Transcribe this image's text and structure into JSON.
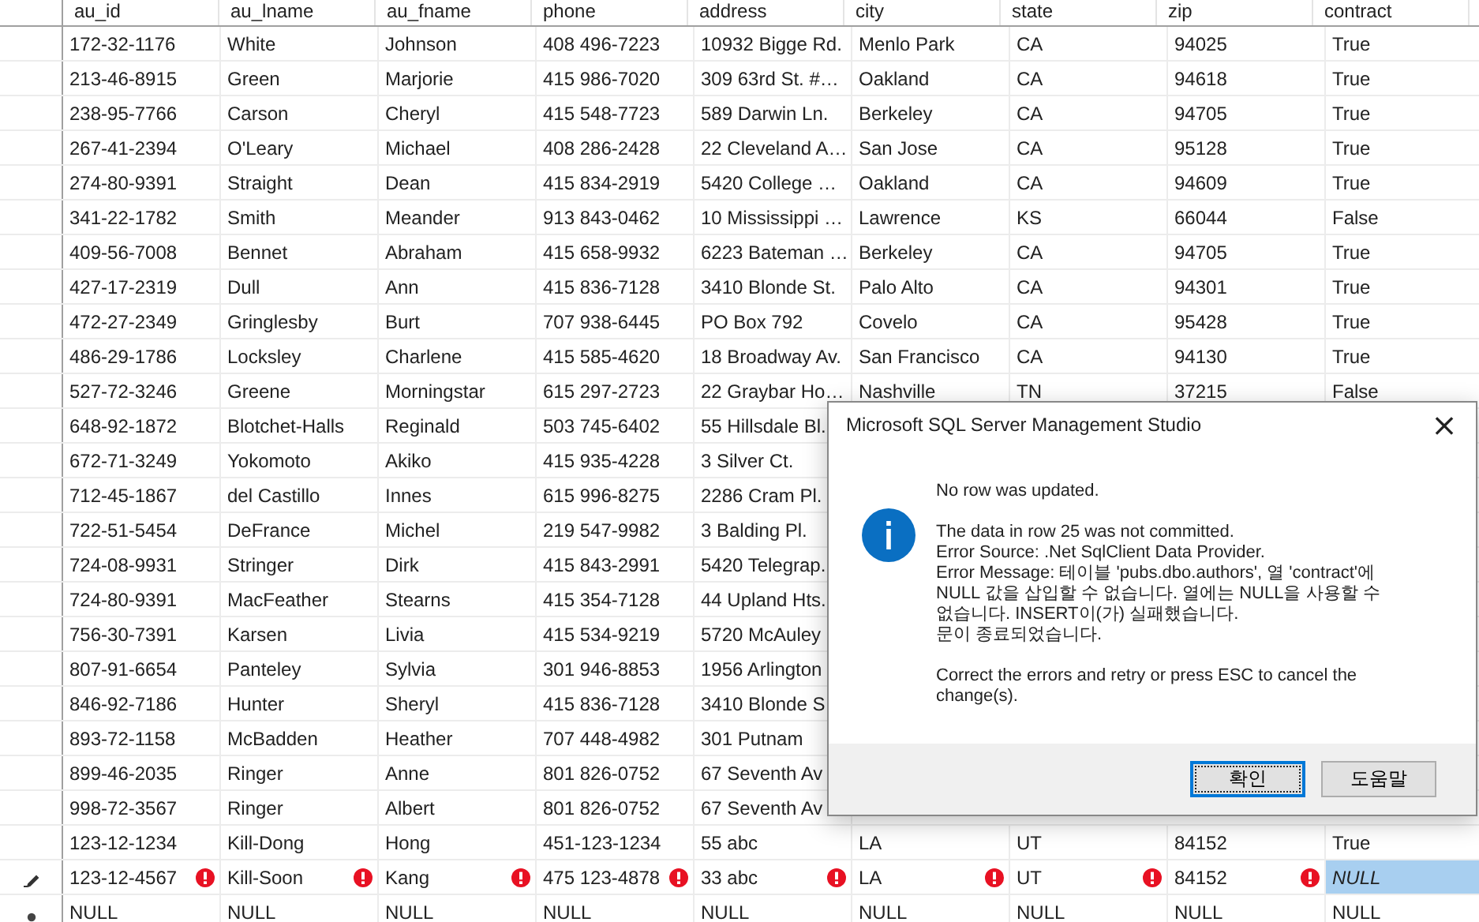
{
  "table": {
    "columns": [
      "au_id",
      "au_lname",
      "au_fname",
      "phone",
      "address",
      "city",
      "state",
      "zip",
      "contract"
    ],
    "rows": [
      {
        "kind": "plain",
        "cells": [
          "172-32-1176",
          "White",
          "Johnson",
          "408 496-7223",
          "10932 Bigge Rd.",
          "Menlo Park",
          "CA",
          "94025",
          "True"
        ]
      },
      {
        "kind": "plain",
        "cells": [
          "213-46-8915",
          "Green",
          "Marjorie",
          "415 986-7020",
          "309 63rd St. #…",
          "Oakland",
          "CA",
          "94618",
          "True"
        ]
      },
      {
        "kind": "plain",
        "cells": [
          "238-95-7766",
          "Carson",
          "Cheryl",
          "415 548-7723",
          "589 Darwin Ln.",
          "Berkeley",
          "CA",
          "94705",
          "True"
        ]
      },
      {
        "kind": "plain",
        "cells": [
          "267-41-2394",
          "O'Leary",
          "Michael",
          "408 286-2428",
          "22 Cleveland A…",
          "San Jose",
          "CA",
          "95128",
          "True"
        ]
      },
      {
        "kind": "plain",
        "cells": [
          "274-80-9391",
          "Straight",
          "Dean",
          "415 834-2919",
          "5420 College …",
          "Oakland",
          "CA",
          "94609",
          "True"
        ]
      },
      {
        "kind": "plain",
        "cells": [
          "341-22-1782",
          "Smith",
          "Meander",
          "913 843-0462",
          "10 Mississippi …",
          "Lawrence",
          "KS",
          "66044",
          "False"
        ]
      },
      {
        "kind": "plain",
        "cells": [
          "409-56-7008",
          "Bennet",
          "Abraham",
          "415 658-9932",
          "6223 Bateman …",
          "Berkeley",
          "CA",
          "94705",
          "True"
        ]
      },
      {
        "kind": "plain",
        "cells": [
          "427-17-2319",
          "Dull",
          "Ann",
          "415 836-7128",
          "3410 Blonde St.",
          "Palo Alto",
          "CA",
          "94301",
          "True"
        ]
      },
      {
        "kind": "plain",
        "cells": [
          "472-27-2349",
          "Gringlesby",
          "Burt",
          "707 938-6445",
          "PO Box 792",
          "Covelo",
          "CA",
          "95428",
          "True"
        ]
      },
      {
        "kind": "plain",
        "cells": [
          "486-29-1786",
          "Locksley",
          "Charlene",
          "415 585-4620",
          "18 Broadway Av.",
          "San Francisco",
          "CA",
          "94130",
          "True"
        ]
      },
      {
        "kind": "plain",
        "cells": [
          "527-72-3246",
          "Greene",
          "Morningstar",
          "615 297-2723",
          "22 Graybar Ho…",
          "Nashville",
          "TN",
          "37215",
          "False"
        ]
      },
      {
        "kind": "plain",
        "cells": [
          "648-92-1872",
          "Blotchet-Halls",
          "Reginald",
          "503 745-6402",
          "55 Hillsdale Bl."
        ]
      },
      {
        "kind": "plain",
        "cells": [
          "672-71-3249",
          "Yokomoto",
          "Akiko",
          "415 935-4228",
          "3 Silver Ct."
        ]
      },
      {
        "kind": "plain",
        "cells": [
          "712-45-1867",
          "del Castillo",
          "Innes",
          "615 996-8275",
          "2286 Cram Pl."
        ]
      },
      {
        "kind": "plain",
        "cells": [
          "722-51-5454",
          "DeFrance",
          "Michel",
          "219 547-9982",
          "3 Balding Pl."
        ]
      },
      {
        "kind": "plain",
        "cells": [
          "724-08-9931",
          "Stringer",
          "Dirk",
          "415 843-2991",
          "5420 Telegrap."
        ]
      },
      {
        "kind": "plain",
        "cells": [
          "724-80-9391",
          "MacFeather",
          "Stearns",
          "415 354-7128",
          "44 Upland Hts."
        ]
      },
      {
        "kind": "plain",
        "cells": [
          "756-30-7391",
          "Karsen",
          "Livia",
          "415 534-9219",
          "5720 McAuley"
        ]
      },
      {
        "kind": "plain",
        "cells": [
          "807-91-6654",
          "Panteley",
          "Sylvia",
          "301 946-8853",
          "1956 Arlington"
        ]
      },
      {
        "kind": "plain",
        "cells": [
          "846-92-7186",
          "Hunter",
          "Sheryl",
          "415 836-7128",
          "3410 Blonde S"
        ]
      },
      {
        "kind": "plain",
        "cells": [
          "893-72-1158",
          "McBadden",
          "Heather",
          "707 448-4982",
          "301 Putnam"
        ]
      },
      {
        "kind": "plain",
        "cells": [
          "899-46-2035",
          "Ringer",
          "Anne",
          "801 826-0752",
          "67 Seventh Av"
        ]
      },
      {
        "kind": "plain",
        "cells": [
          "998-72-3567",
          "Ringer",
          "Albert",
          "801 826-0752",
          "67 Seventh Av"
        ]
      },
      {
        "kind": "plain",
        "cells": [
          "123-12-1234",
          "Kill-Dong",
          "Hong",
          "451-123-1234",
          "55 abc",
          "LA",
          "UT",
          "84152",
          "True"
        ]
      },
      {
        "kind": "editing",
        "cells": [
          {
            "text": "123-12-4567",
            "error": true,
            "selected": false
          },
          {
            "text": "Kill-Soon",
            "error": true,
            "selected": false
          },
          {
            "text": "Kang",
            "error": true,
            "selected": false
          },
          {
            "text": "475 123-4878",
            "error": true,
            "selected": false
          },
          {
            "text": "33 abc",
            "error": true,
            "selected": false
          },
          {
            "text": "LA",
            "error": true,
            "selected": false
          },
          {
            "text": "UT",
            "error": true,
            "selected": false
          },
          {
            "text": "84152",
            "error": true,
            "selected": false
          },
          {
            "text": "NULL",
            "error": false,
            "selected": true
          }
        ]
      },
      {
        "kind": "new",
        "cells": [
          "NULL",
          "NULL",
          "NULL",
          "NULL",
          "NULL",
          "NULL",
          "NULL",
          "NULL",
          "NULL"
        ]
      }
    ]
  },
  "dialog": {
    "title": "Microsoft SQL Server Management Studio",
    "close": "×",
    "paragraphs": [
      "No row was updated.",
      "The data in row 25 was not committed.\nError Source: .Net SqlClient Data Provider.\nError Message: 테이블 'pubs.dbo.authors', 열 'contract'에 NULL 값을 삽입할 수 없습니다. 열에는 NULL을 사용할 수 없습니다. INSERT이(가) 실패했습니다.\n문이 종료되었습니다.",
      "Correct the errors and retry or press ESC to cancel the change(s)."
    ],
    "buttons": [
      {
        "label": "확인",
        "focused": true
      },
      {
        "label": "도움말",
        "focused": false
      }
    ]
  }
}
